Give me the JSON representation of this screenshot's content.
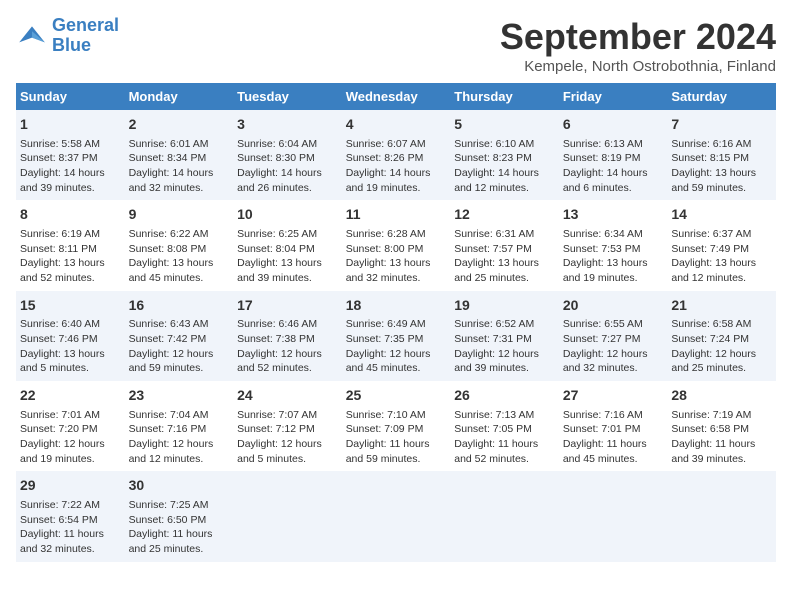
{
  "logo": {
    "line1": "General",
    "line2": "Blue"
  },
  "title": "September 2024",
  "subtitle": "Kempele, North Ostrobothnia, Finland",
  "days_header": [
    "Sunday",
    "Monday",
    "Tuesday",
    "Wednesday",
    "Thursday",
    "Friday",
    "Saturday"
  ],
  "weeks": [
    [
      {
        "num": "1",
        "sunrise": "Sunrise: 5:58 AM",
        "sunset": "Sunset: 8:37 PM",
        "daylight": "Daylight: 14 hours and 39 minutes."
      },
      {
        "num": "2",
        "sunrise": "Sunrise: 6:01 AM",
        "sunset": "Sunset: 8:34 PM",
        "daylight": "Daylight: 14 hours and 32 minutes."
      },
      {
        "num": "3",
        "sunrise": "Sunrise: 6:04 AM",
        "sunset": "Sunset: 8:30 PM",
        "daylight": "Daylight: 14 hours and 26 minutes."
      },
      {
        "num": "4",
        "sunrise": "Sunrise: 6:07 AM",
        "sunset": "Sunset: 8:26 PM",
        "daylight": "Daylight: 14 hours and 19 minutes."
      },
      {
        "num": "5",
        "sunrise": "Sunrise: 6:10 AM",
        "sunset": "Sunset: 8:23 PM",
        "daylight": "Daylight: 14 hours and 12 minutes."
      },
      {
        "num": "6",
        "sunrise": "Sunrise: 6:13 AM",
        "sunset": "Sunset: 8:19 PM",
        "daylight": "Daylight: 14 hours and 6 minutes."
      },
      {
        "num": "7",
        "sunrise": "Sunrise: 6:16 AM",
        "sunset": "Sunset: 8:15 PM",
        "daylight": "Daylight: 13 hours and 59 minutes."
      }
    ],
    [
      {
        "num": "8",
        "sunrise": "Sunrise: 6:19 AM",
        "sunset": "Sunset: 8:11 PM",
        "daylight": "Daylight: 13 hours and 52 minutes."
      },
      {
        "num": "9",
        "sunrise": "Sunrise: 6:22 AM",
        "sunset": "Sunset: 8:08 PM",
        "daylight": "Daylight: 13 hours and 45 minutes."
      },
      {
        "num": "10",
        "sunrise": "Sunrise: 6:25 AM",
        "sunset": "Sunset: 8:04 PM",
        "daylight": "Daylight: 13 hours and 39 minutes."
      },
      {
        "num": "11",
        "sunrise": "Sunrise: 6:28 AM",
        "sunset": "Sunset: 8:00 PM",
        "daylight": "Daylight: 13 hours and 32 minutes."
      },
      {
        "num": "12",
        "sunrise": "Sunrise: 6:31 AM",
        "sunset": "Sunset: 7:57 PM",
        "daylight": "Daylight: 13 hours and 25 minutes."
      },
      {
        "num": "13",
        "sunrise": "Sunrise: 6:34 AM",
        "sunset": "Sunset: 7:53 PM",
        "daylight": "Daylight: 13 hours and 19 minutes."
      },
      {
        "num": "14",
        "sunrise": "Sunrise: 6:37 AM",
        "sunset": "Sunset: 7:49 PM",
        "daylight": "Daylight: 13 hours and 12 minutes."
      }
    ],
    [
      {
        "num": "15",
        "sunrise": "Sunrise: 6:40 AM",
        "sunset": "Sunset: 7:46 PM",
        "daylight": "Daylight: 13 hours and 5 minutes."
      },
      {
        "num": "16",
        "sunrise": "Sunrise: 6:43 AM",
        "sunset": "Sunset: 7:42 PM",
        "daylight": "Daylight: 12 hours and 59 minutes."
      },
      {
        "num": "17",
        "sunrise": "Sunrise: 6:46 AM",
        "sunset": "Sunset: 7:38 PM",
        "daylight": "Daylight: 12 hours and 52 minutes."
      },
      {
        "num": "18",
        "sunrise": "Sunrise: 6:49 AM",
        "sunset": "Sunset: 7:35 PM",
        "daylight": "Daylight: 12 hours and 45 minutes."
      },
      {
        "num": "19",
        "sunrise": "Sunrise: 6:52 AM",
        "sunset": "Sunset: 7:31 PM",
        "daylight": "Daylight: 12 hours and 39 minutes."
      },
      {
        "num": "20",
        "sunrise": "Sunrise: 6:55 AM",
        "sunset": "Sunset: 7:27 PM",
        "daylight": "Daylight: 12 hours and 32 minutes."
      },
      {
        "num": "21",
        "sunrise": "Sunrise: 6:58 AM",
        "sunset": "Sunset: 7:24 PM",
        "daylight": "Daylight: 12 hours and 25 minutes."
      }
    ],
    [
      {
        "num": "22",
        "sunrise": "Sunrise: 7:01 AM",
        "sunset": "Sunset: 7:20 PM",
        "daylight": "Daylight: 12 hours and 19 minutes."
      },
      {
        "num": "23",
        "sunrise": "Sunrise: 7:04 AM",
        "sunset": "Sunset: 7:16 PM",
        "daylight": "Daylight: 12 hours and 12 minutes."
      },
      {
        "num": "24",
        "sunrise": "Sunrise: 7:07 AM",
        "sunset": "Sunset: 7:12 PM",
        "daylight": "Daylight: 12 hours and 5 minutes."
      },
      {
        "num": "25",
        "sunrise": "Sunrise: 7:10 AM",
        "sunset": "Sunset: 7:09 PM",
        "daylight": "Daylight: 11 hours and 59 minutes."
      },
      {
        "num": "26",
        "sunrise": "Sunrise: 7:13 AM",
        "sunset": "Sunset: 7:05 PM",
        "daylight": "Daylight: 11 hours and 52 minutes."
      },
      {
        "num": "27",
        "sunrise": "Sunrise: 7:16 AM",
        "sunset": "Sunset: 7:01 PM",
        "daylight": "Daylight: 11 hours and 45 minutes."
      },
      {
        "num": "28",
        "sunrise": "Sunrise: 7:19 AM",
        "sunset": "Sunset: 6:58 PM",
        "daylight": "Daylight: 11 hours and 39 minutes."
      }
    ],
    [
      {
        "num": "29",
        "sunrise": "Sunrise: 7:22 AM",
        "sunset": "Sunset: 6:54 PM",
        "daylight": "Daylight: 11 hours and 32 minutes."
      },
      {
        "num": "30",
        "sunrise": "Sunrise: 7:25 AM",
        "sunset": "Sunset: 6:50 PM",
        "daylight": "Daylight: 11 hours and 25 minutes."
      },
      null,
      null,
      null,
      null,
      null
    ]
  ]
}
